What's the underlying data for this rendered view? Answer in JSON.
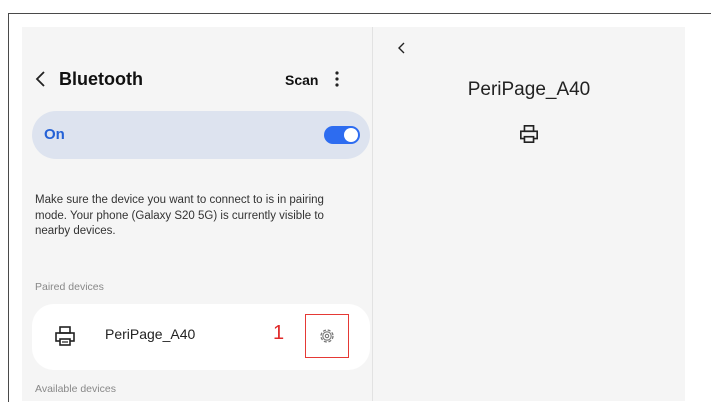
{
  "left_panel": {
    "header": {
      "back_icon": "chevron-left-icon",
      "title": "Bluetooth",
      "scan_label": "Scan",
      "more_icon": "more-vertical-icon"
    },
    "toggle": {
      "label": "On",
      "state": "on",
      "accent": "#2d6cf0"
    },
    "info_text": "Make sure the device you want to connect to is in pairing mode. Your phone (Galaxy S20 5G) is currently visible to nearby devices.",
    "paired_section": "Paired devices",
    "paired_devices": [
      {
        "icon": "printer-icon",
        "name": "PeriPage_A40",
        "step_label": "1",
        "settings_icon": "gear-icon"
      }
    ],
    "available_section": "Available devices"
  },
  "right_panel": {
    "back_icon": "chevron-left-icon",
    "title": "PeriPage_A40",
    "device_icon": "printer-icon"
  },
  "colors": {
    "highlight": "#e53935",
    "step": "#e02a2a",
    "card": "#dde3ef"
  }
}
